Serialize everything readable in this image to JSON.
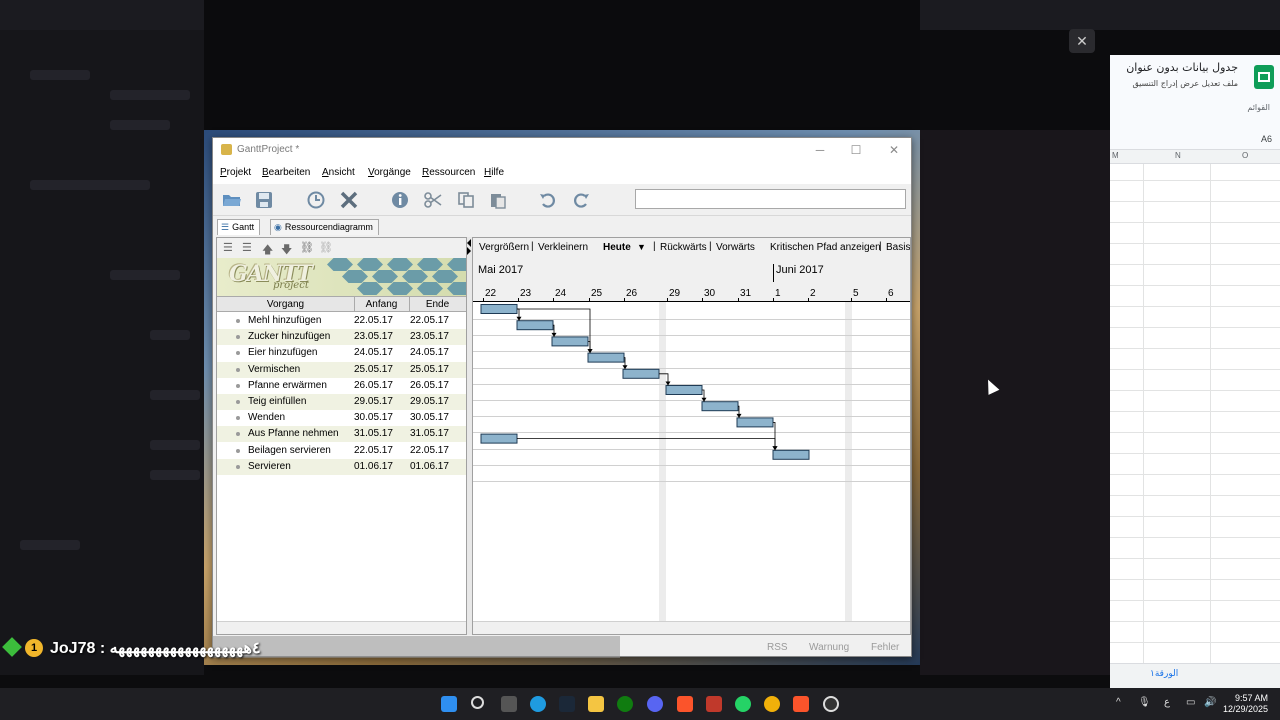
{
  "window": {
    "title": "GanttProject *",
    "minimize": "─",
    "maximize": "☐",
    "close": "✕"
  },
  "menu": [
    "Projekt",
    "Bearbeiten",
    "Ansicht",
    "Vorgänge",
    "Ressourcen",
    "Hilfe"
  ],
  "toolbar": {
    "icons": [
      "open-folder-icon",
      "save-icon",
      "history-icon",
      "delete-icon",
      "info-icon",
      "cut-icon",
      "copy-icon",
      "paste-icon",
      "undo-icon",
      "redo-icon"
    ],
    "search_value": ""
  },
  "tabs": [
    {
      "label": "Gantt",
      "icon": "gantt-icon",
      "active": true
    },
    {
      "label": "Ressourcendiagramm",
      "icon": "resource-icon",
      "active": false
    }
  ],
  "logo": {
    "text": "GANTT",
    "sub": "project"
  },
  "tree": {
    "columns": [
      "Vorgang",
      "Anfang",
      "Ende"
    ],
    "rows": [
      {
        "name": "Mehl hinzufügen",
        "start": "22.05.17",
        "end": "22.05.17"
      },
      {
        "name": "Zucker hinzufügen",
        "start": "23.05.17",
        "end": "23.05.17"
      },
      {
        "name": "Eier hinzufügen",
        "start": "24.05.17",
        "end": "24.05.17"
      },
      {
        "name": "Vermischen",
        "start": "25.05.17",
        "end": "25.05.17"
      },
      {
        "name": "Pfanne erwärmen",
        "start": "26.05.17",
        "end": "26.05.17"
      },
      {
        "name": "Teig einfüllen",
        "start": "29.05.17",
        "end": "29.05.17"
      },
      {
        "name": "Wenden",
        "start": "30.05.17",
        "end": "30.05.17"
      },
      {
        "name": "Aus Pfanne nehmen",
        "start": "31.05.17",
        "end": "31.05.17"
      },
      {
        "name": "Beilagen servieren",
        "start": "22.05.17",
        "end": "22.05.17"
      },
      {
        "name": "Servieren",
        "start": "01.06.17",
        "end": "01.06.17"
      }
    ]
  },
  "chart_toolbar": {
    "zoom_in": "Vergrößern",
    "zoom_out": "Verkleinern",
    "today": "Heute",
    "back": "Rückwärts",
    "forward": "Vorwärts",
    "critical_path": "Kritischen Pfad anzeigen",
    "baseline": "Basisp"
  },
  "timeline": {
    "months": [
      "Mai 2017",
      "Juni 2017"
    ],
    "days": [
      "22",
      "23",
      "24",
      "25",
      "26",
      "29",
      "30",
      "31",
      "1",
      "2",
      "5",
      "6"
    ]
  },
  "status": {
    "rss": "RSS",
    "warning": "Warnung",
    "error": "Fehler"
  },
  "sheet": {
    "title": "جدول بيانات بدون عنوان",
    "menu": "ملف  تعديل  عرض  إدراج  التنسيق",
    "search": "القوائم",
    "cell_ref": "A6",
    "columns": [
      "O",
      "N",
      "M"
    ],
    "tab": "الورقة١"
  },
  "chat": {
    "user": "JoJ78",
    "badge": "1",
    "message": "JoJ78 : ٤ههههههههههههههههههه"
  },
  "clock": {
    "time": "9:57 AM",
    "date": "12/29/2025"
  },
  "overlay_close": "✕",
  "colors": {
    "bar_fill": "#8db3cc",
    "bar_stroke": "#1f3b55",
    "row_alt": "#f0f2e2"
  }
}
